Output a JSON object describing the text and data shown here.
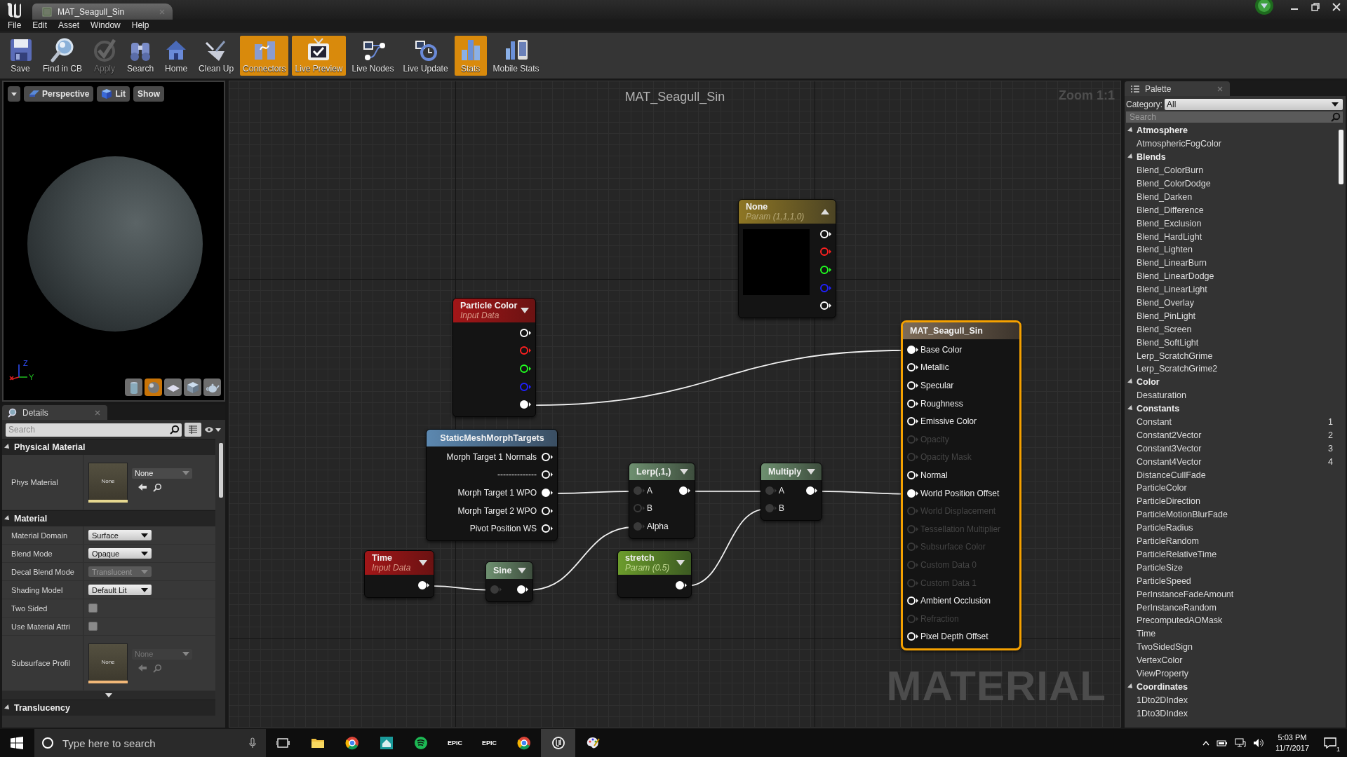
{
  "title_bar": {
    "tab": "MAT_Seagull_Sin"
  },
  "menu": [
    "File",
    "Edit",
    "Asset",
    "Window",
    "Help"
  ],
  "toolbar": [
    {
      "kind": "save",
      "label": "Save",
      "on": false,
      "disabled": false
    },
    {
      "kind": "find",
      "label": "Find in CB",
      "on": false,
      "disabled": false
    },
    {
      "kind": "apply",
      "label": "Apply",
      "on": false,
      "disabled": true
    },
    {
      "kind": "search",
      "label": "Search",
      "on": false,
      "disabled": false
    },
    {
      "kind": "home",
      "label": "Home",
      "on": false,
      "disabled": false
    },
    {
      "kind": "cleanup",
      "label": "Clean Up",
      "on": false,
      "disabled": false
    },
    {
      "kind": "connectors",
      "label": "Connectors",
      "on": true,
      "disabled": false
    },
    {
      "kind": "live_preview",
      "label": "Live Preview",
      "on": true,
      "disabled": false
    },
    {
      "kind": "live_nodes",
      "label": "Live Nodes",
      "on": false,
      "disabled": false
    },
    {
      "kind": "live_update",
      "label": "Live Update",
      "on": false,
      "disabled": false
    },
    {
      "kind": "stats",
      "label": "Stats",
      "on": true,
      "disabled": false
    },
    {
      "kind": "mobile_stats",
      "label": "Mobile Stats",
      "on": false,
      "disabled": false
    }
  ],
  "viewport": {
    "buttons": [
      {
        "kind": "menu"
      },
      {
        "kind": "perspective",
        "label": "Perspective"
      },
      {
        "kind": "lit",
        "label": "Lit"
      },
      {
        "kind": "plain",
        "label": "Show"
      }
    ],
    "axes": [
      "Z",
      "Y"
    ],
    "preview_shapes": [
      {
        "kind": "cylinder",
        "selected": false
      },
      {
        "kind": "sphere",
        "selected": true
      },
      {
        "kind": "plane",
        "selected": false
      },
      {
        "kind": "cube",
        "selected": false
      },
      {
        "kind": "teapot",
        "selected": false
      }
    ]
  },
  "details": {
    "tab": "Details",
    "search": {
      "placeholder": "Search"
    },
    "sections": [
      {
        "title": "Physical Material",
        "rows": [
          {
            "kind": "asset",
            "label": "Phys Material",
            "thumb": "None",
            "value": "None",
            "disabled": false,
            "color": "#e6d890"
          }
        ]
      },
      {
        "title": "Material",
        "rows": [
          {
            "kind": "dropdown",
            "label": "Material Domain",
            "value": "Surface",
            "disabled": false
          },
          {
            "kind": "dropdown",
            "label": "Blend Mode",
            "value": "Opaque",
            "disabled": false
          },
          {
            "kind": "dropdown",
            "label": "Decal Blend Mode",
            "value": "Translucent",
            "disabled": true
          },
          {
            "kind": "dropdown",
            "label": "Shading Model",
            "value": "Default Lit",
            "disabled": false
          },
          {
            "kind": "checkbox",
            "label": "Two Sided",
            "checked": false
          },
          {
            "kind": "checkbox",
            "label": "Use Material Attri",
            "checked": false
          },
          {
            "kind": "asset",
            "label": "Subsurface Profil",
            "thumb": "None",
            "value": "None",
            "disabled": true,
            "color": "#f2b878"
          }
        ]
      },
      {
        "title": "Translucency"
      }
    ]
  },
  "graph": {
    "title": "MAT_Seagull_Sin",
    "zoom": "Zoom 1:1",
    "watermark": "MATERIAL",
    "nodes": [
      {
        "kind": "vector_param",
        "title": "None",
        "subtitle": "Param (1,1,1,0)",
        "expanded": true,
        "preview": true,
        "rows": [
          {
            "output": {
              "connected": false,
              "color": "#ffffff"
            }
          },
          {
            "output": {
              "connected": false,
              "color": "#ff2020"
            }
          },
          {
            "output": {
              "connected": false,
              "color": "#20ff20"
            }
          },
          {
            "output": {
              "connected": false,
              "color": "#2020ff"
            }
          },
          {
            "output": {
              "connected": false,
              "color": "#ffffff"
            }
          }
        ]
      },
      {
        "kind": "input",
        "title": "Particle Color",
        "subtitle": "Input Data",
        "expanded": false,
        "rows": [
          {
            "output": {
              "connected": false,
              "color": "#ffffff"
            }
          },
          {
            "output": {
              "connected": false,
              "color": "#ff2020"
            }
          },
          {
            "output": {
              "connected": false,
              "color": "#20ff20"
            }
          },
          {
            "output": {
              "connected": false,
              "color": "#2020ff"
            }
          },
          {
            "output": {
              "connected": true,
              "color": "#ffffff"
            }
          }
        ]
      },
      {
        "kind": "function",
        "title": "StaticMeshMorphTargets",
        "rows": [
          {
            "output": {
              "label": "Morph Target 1 Normals",
              "connected": false
            }
          },
          {
            "output": {
              "label": "--------------",
              "connected": false
            }
          },
          {
            "output": {
              "label": "Morph Target 1 WPO",
              "connected": true
            }
          },
          {
            "output": {
              "label": "Morph Target 2 WPO",
              "connected": false
            }
          },
          {
            "output": {
              "label": "Pivot Position WS",
              "connected": false
            }
          }
        ]
      },
      {
        "kind": "math",
        "title": "Lerp(,1,)",
        "expanded": false,
        "rows": [
          {
            "input": {
              "label": "A",
              "connected": true
            },
            "output": {
              "connected": true
            }
          },
          {
            "input": {
              "label": "B",
              "connected": false
            }
          },
          {
            "input": {
              "label": "Alpha",
              "connected": true
            }
          }
        ]
      },
      {
        "kind": "math",
        "title": "Multiply",
        "expanded": false,
        "rows": [
          {
            "input": {
              "label": "A",
              "connected": true
            },
            "output": {
              "connected": true
            }
          },
          {
            "input": {
              "label": "B",
              "connected": true
            }
          }
        ]
      },
      {
        "kind": "input",
        "title": "Time",
        "subtitle": "Input Data",
        "expanded": false,
        "rows": [
          {
            "output": {
              "connected": true
            }
          }
        ]
      },
      {
        "kind": "math",
        "title": "Sine",
        "expanded": false,
        "rows": [
          {
            "input": {
              "connected": true
            },
            "output": {
              "connected": true
            }
          }
        ]
      },
      {
        "kind": "scalar_param",
        "title": "stretch",
        "subtitle": "Param (0.5)",
        "expanded": false,
        "rows": [
          {
            "output": {
              "connected": true
            }
          }
        ]
      },
      {
        "kind": "result",
        "title": "MAT_Seagull_Sin",
        "selected": true,
        "rows": [
          {
            "input": {
              "label": "Base Color",
              "connected": true,
              "disabled": false
            }
          },
          {
            "input": {
              "label": "Metallic",
              "connected": false,
              "disabled": false
            }
          },
          {
            "input": {
              "label": "Specular",
              "connected": false,
              "disabled": false
            }
          },
          {
            "input": {
              "label": "Roughness",
              "connected": false,
              "disabled": false
            }
          },
          {
            "input": {
              "label": "Emissive Color",
              "connected": false,
              "disabled": false
            }
          },
          {
            "input": {
              "label": "Opacity",
              "connected": false,
              "disabled": true
            }
          },
          {
            "input": {
              "label": "Opacity Mask",
              "connected": false,
              "disabled": true
            }
          },
          {
            "input": {
              "label": "Normal",
              "connected": false,
              "disabled": false
            }
          },
          {
            "input": {
              "label": "World Position Offset",
              "connected": true,
              "disabled": false
            }
          },
          {
            "input": {
              "label": "World Displacement",
              "connected": false,
              "disabled": true
            }
          },
          {
            "input": {
              "label": "Tessellation Multiplier",
              "connected": false,
              "disabled": true
            }
          },
          {
            "input": {
              "label": "Subsurface Color",
              "connected": false,
              "disabled": true
            }
          },
          {
            "input": {
              "label": "Custom Data 0",
              "connected": false,
              "disabled": true
            }
          },
          {
            "input": {
              "label": "Custom Data 1",
              "connected": false,
              "disabled": true
            }
          },
          {
            "input": {
              "label": "Ambient Occlusion",
              "connected": false,
              "disabled": false
            }
          },
          {
            "input": {
              "label": "Refraction",
              "connected": false,
              "disabled": true
            }
          },
          {
            "input": {
              "label": "Pixel Depth Offset",
              "connected": false,
              "disabled": false
            }
          }
        ]
      }
    ]
  },
  "palette": {
    "tab": "Palette",
    "category_label": "Category:",
    "category": "All",
    "search": {
      "placeholder": "Search"
    },
    "groups": [
      {
        "title": "Atmosphere",
        "expanded": true,
        "items": [
          {
            "label": "AtmosphericFogColor"
          }
        ]
      },
      {
        "title": "Blends",
        "expanded": true,
        "items": [
          {
            "label": "Blend_ColorBurn"
          },
          {
            "label": "Blend_ColorDodge"
          },
          {
            "label": "Blend_Darken"
          },
          {
            "label": "Blend_Difference"
          },
          {
            "label": "Blend_Exclusion"
          },
          {
            "label": "Blend_HardLight"
          },
          {
            "label": "Blend_Lighten"
          },
          {
            "label": "Blend_LinearBurn"
          },
          {
            "label": "Blend_LinearDodge"
          },
          {
            "label": "Blend_LinearLight"
          },
          {
            "label": "Blend_Overlay"
          },
          {
            "label": "Blend_PinLight"
          },
          {
            "label": "Blend_Screen"
          },
          {
            "label": "Blend_SoftLight"
          },
          {
            "label": "Lerp_ScratchGrime"
          },
          {
            "label": "Lerp_ScratchGrime2"
          }
        ]
      },
      {
        "title": "Color",
        "expanded": true,
        "items": [
          {
            "label": "Desaturation"
          }
        ]
      },
      {
        "title": "Constants",
        "expanded": true,
        "items": [
          {
            "label": "Constant",
            "hotkey": "1"
          },
          {
            "label": "Constant2Vector",
            "hotkey": "2"
          },
          {
            "label": "Constant3Vector",
            "hotkey": "3"
          },
          {
            "label": "Constant4Vector",
            "hotkey": "4"
          },
          {
            "label": "DistanceCullFade"
          },
          {
            "label": "ParticleColor"
          },
          {
            "label": "ParticleDirection"
          },
          {
            "label": "ParticleMotionBlurFade"
          },
          {
            "label": "ParticleRadius"
          },
          {
            "label": "ParticleRandom"
          },
          {
            "label": "ParticleRelativeTime"
          },
          {
            "label": "ParticleSize"
          },
          {
            "label": "ParticleSpeed"
          },
          {
            "label": "PerInstanceFadeAmount"
          },
          {
            "label": "PerInstanceRandom"
          },
          {
            "label": "PrecomputedAOMask"
          },
          {
            "label": "Time"
          },
          {
            "label": "TwoSidedSign"
          },
          {
            "label": "VertexColor"
          },
          {
            "label": "ViewProperty"
          }
        ]
      },
      {
        "title": "Coordinates",
        "expanded": true,
        "items": [
          {
            "label": "1Dto2DIndex"
          },
          {
            "label": "1Dto3DIndex"
          }
        ]
      }
    ]
  },
  "taskbar": {
    "search_placeholder": "Type here to search",
    "apps": [
      {
        "kind": "task_view",
        "active": false
      },
      {
        "kind": "explorer",
        "active": false
      },
      {
        "kind": "chrome",
        "active": false
      },
      {
        "kind": "app",
        "active": false
      },
      {
        "kind": "spotify",
        "active": false
      },
      {
        "kind": "epic",
        "label": "EPIC",
        "active": false
      },
      {
        "kind": "epic",
        "label": "EPIC",
        "active": false
      },
      {
        "kind": "chrome",
        "active": false
      },
      {
        "kind": "unreal",
        "active": true
      },
      {
        "kind": "paint",
        "active": false
      }
    ],
    "time": "5:03 PM",
    "date": "11/7/2017",
    "notifications": "1"
  }
}
